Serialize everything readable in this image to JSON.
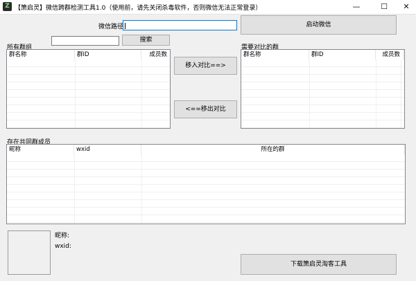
{
  "window": {
    "title": "【箫启灵】微信跨群检测工具1.0（使用前，请先关闭杀毒软件，否则微信无法正常登录）",
    "icon_letter": "Z",
    "controls": {
      "minimize": "—",
      "maximize": "☐",
      "close": "✕"
    }
  },
  "top": {
    "wechat_path_label": "微信路径:",
    "wechat_path_value": "",
    "launch_button": "启动微信"
  },
  "search": {
    "value": "",
    "button": "搜索"
  },
  "all_groups": {
    "label": "所有群组",
    "columns": [
      "群名称",
      "群ID",
      "成员数"
    ]
  },
  "compare_groups": {
    "label": "需要对比的群",
    "columns": [
      "群名称",
      "群ID",
      "成员数"
    ]
  },
  "move_in_button": "移入对比==>",
  "move_out_button": "<==移出对比",
  "common_members": {
    "label": "存在共同群成员",
    "columns": [
      "昵称",
      "wxid",
      "所在的群"
    ]
  },
  "detail": {
    "nickname_label": "昵称:",
    "wxid_label": "wxid:"
  },
  "download_button": "下载箫启灵淘客工具"
}
